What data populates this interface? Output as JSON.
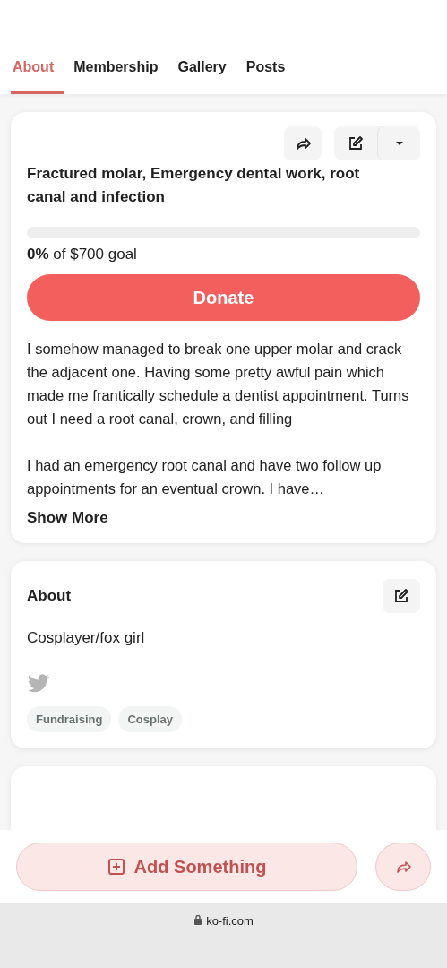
{
  "tabs": [
    {
      "label": "About",
      "selected": true
    },
    {
      "label": "Membership",
      "selected": false
    },
    {
      "label": "Gallery",
      "selected": false
    },
    {
      "label": "Posts",
      "selected": false
    }
  ],
  "goal_card": {
    "title": "Fractured molar, Emergency dental work, root canal and infection",
    "level": 0,
    "percent": "0%",
    "goal_text": "of $700 goal",
    "donate": "Donate",
    "paragraphs": [
      "I somehow managed to break one upper molar and crack the adjacent one. Having some pretty awful pain which made me frantically schedule a dentist appointment. Turns out I need a root canal, crown, and filling",
      "I had an emergency root canal and have two follow up appointments for an eventual crown. I have…"
    ],
    "show_more": "Show More"
  },
  "about_card": {
    "title": "About",
    "bio": "Cosplayer/fox girl",
    "tags": [
      "Fundraising",
      "Cosplay"
    ]
  },
  "bottom_bar": {
    "add_button": "Add Something"
  },
  "address_bar": {
    "url": "ko-fi.com"
  }
}
